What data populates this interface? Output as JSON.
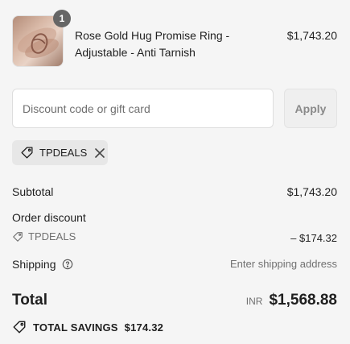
{
  "cart": {
    "item": {
      "name": "Rose Gold Hug Promise Ring - Adjustable - Anti Tarnish",
      "price": "$1,743.20",
      "quantity": "1",
      "image_icon": "ring-product-image"
    }
  },
  "discount": {
    "placeholder": "Discount code or gift card",
    "value": "",
    "apply_label": "Apply",
    "applied_code": "TPDEALS"
  },
  "summary": {
    "subtotal_label": "Subtotal",
    "subtotal_value": "$1,743.20",
    "order_discount_label": "Order discount",
    "discount_code": "TPDEALS",
    "discount_value": "– $174.32",
    "shipping_label": "Shipping",
    "shipping_value": "Enter shipping address",
    "total_label": "Total",
    "total_currency": "INR",
    "total_value": "$1,568.88",
    "savings_label": "TOTAL SAVINGS",
    "savings_value": "$174.32"
  },
  "colors": {
    "background": "#f5f5f5",
    "badge": "#666666",
    "muted_text": "#707070",
    "chip_bg": "#e7e7e7"
  }
}
